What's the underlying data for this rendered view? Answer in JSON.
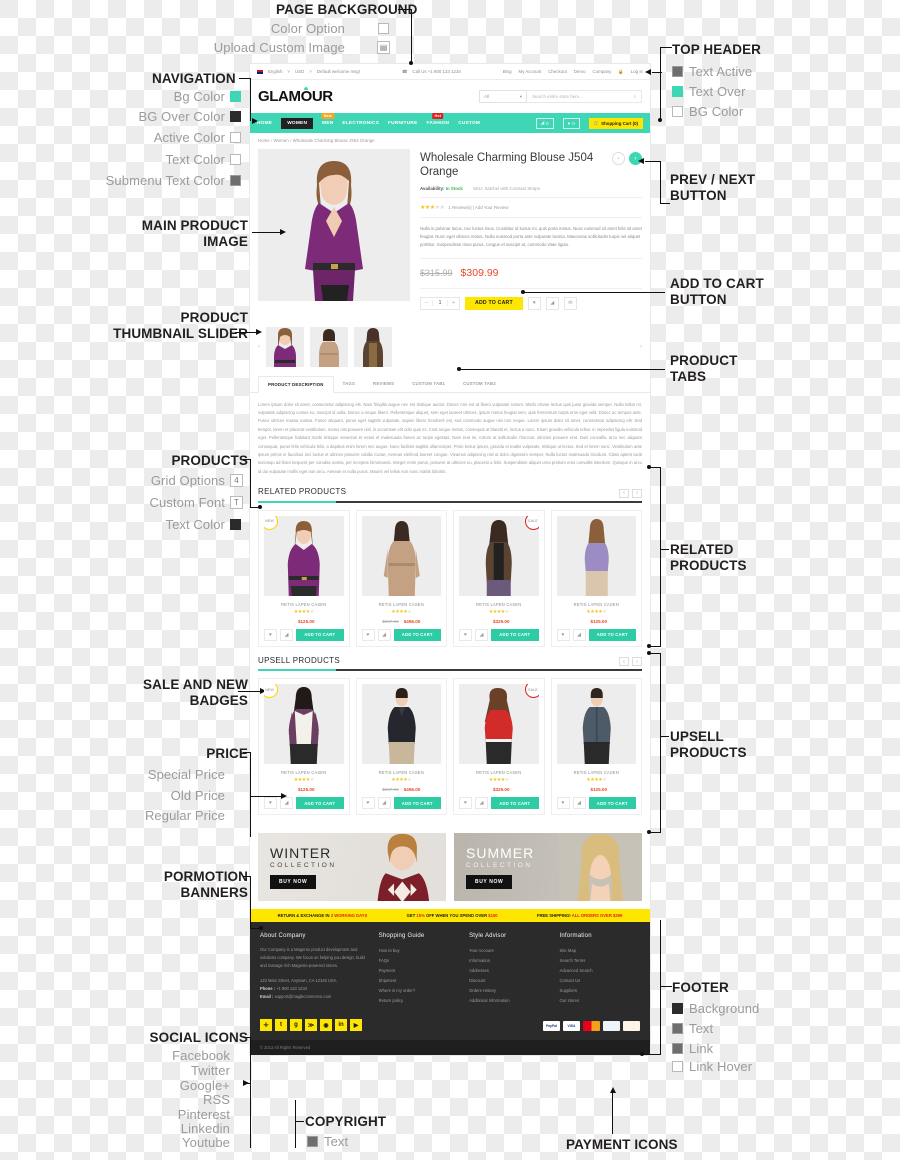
{
  "annotations": {
    "page_background": {
      "title": "PAGE BACKGROUND",
      "options": [
        {
          "label": "Color Option",
          "swatch": "white"
        },
        {
          "label": "Upload Custom Image",
          "swatch": "image"
        }
      ]
    },
    "navigation": {
      "title": "NAVIGATION",
      "options": [
        {
          "label": "Bg Color",
          "swatch": "teal"
        },
        {
          "label": "BG Over Color",
          "swatch": "dark"
        },
        {
          "label": "Active  Color",
          "swatch": "white"
        },
        {
          "label": "Text Color",
          "swatch": "white"
        },
        {
          "label": "Submenu Text Color",
          "swatch": "mid"
        }
      ]
    },
    "top_header": {
      "title": "TOP HEADER",
      "options": [
        {
          "label": "Text Active",
          "swatch": "mid"
        },
        {
          "label": "Text Over",
          "swatch": "teal"
        },
        {
          "label": "BG Color",
          "swatch": "white"
        }
      ]
    },
    "main_product_image": "MAIN PRODUCT IMAGE",
    "product_thumbnail_slider": "PRODUCT THUMBNAIL SLIDER",
    "prev_next_button": "PREV / NEXT BUTTON",
    "add_to_cart_button": "ADD TO CART BUTTON",
    "product_tabs": "PRODUCT TABS",
    "products": {
      "title": "PRODUCTS",
      "options": [
        {
          "label": "Grid Options",
          "glyph": "4"
        },
        {
          "label": "Custom Font",
          "glyph": "T"
        },
        {
          "label": "Text Color",
          "swatch": "dark"
        }
      ]
    },
    "related_products": "RELATED PRODUCTS",
    "upsell_products": "UPSELL PRODUCTS",
    "sale_and_new_badges": "SALE AND NEW BADGES",
    "price": {
      "title": "PRICE",
      "options": [
        "Special Price",
        "Old Price",
        "Regular Price"
      ]
    },
    "promotion_banners": "PORMOTION BANNERS",
    "social_icons": {
      "title": "SOCIAL ICONS",
      "items": [
        "Facebook",
        "Twitter",
        "Google+",
        "RSS",
        "Pinterest",
        "Linkedin",
        "Youtube"
      ]
    },
    "copyright": {
      "title": "COPYRIGHT",
      "options": [
        {
          "label": "Text",
          "swatch": "mid"
        }
      ]
    },
    "footer": {
      "title": "FOOTER",
      "options": [
        {
          "label": "Background",
          "swatch": "dark"
        },
        {
          "label": "Text",
          "swatch": "mid"
        },
        {
          "label": "Link",
          "swatch": "mid"
        },
        {
          "label": "Link Hover",
          "swatch": "white"
        }
      ]
    },
    "payment_icons": "PAYMENT ICONS"
  },
  "site": {
    "topbar": {
      "language": "English",
      "currency": "USD",
      "welcome": "Default welcome msg!",
      "phone": "Call Us +1 800 123 1234",
      "links": [
        "Blog",
        "My Account",
        "Checkout",
        "Demo",
        "Company",
        "Log In"
      ]
    },
    "header": {
      "logo": "GLAMOUR",
      "category_select": "All",
      "search_placeholder": "Search entire store here..."
    },
    "nav": {
      "items": [
        {
          "label": "HOME",
          "badge": ""
        },
        {
          "label": "WOMEN",
          "badge": "",
          "active": true
        },
        {
          "label": "MEN",
          "badge": "New"
        },
        {
          "label": "ELECTRONICS",
          "badge": ""
        },
        {
          "label": "FURNITURE",
          "badge": ""
        },
        {
          "label": "FASHION",
          "badge": "Hot"
        },
        {
          "label": "CUSTOM",
          "badge": ""
        }
      ],
      "compare_count": "0",
      "wishlist_count": "0",
      "cart_label": "Shopping Cart (0)"
    },
    "breadcrumb": "Home  ›  Women  ›  Wholesale Charming Blouse J504 Orange",
    "product": {
      "title": "Wholesale Charming Blouse J504 Orange",
      "availability_label": "Availability:",
      "availability_value": "In Stock",
      "sku": "SKU: Satchel with Contrast Straps",
      "stars": "★★★",
      "stars_empty": "★★",
      "reviews": "1 Review(s)  |  Add Your Review",
      "description": "Nulla in pulvinar lacus, nec luctus risus. Curabitur id luctus mi, quis porta metus. Nunc euismod sit amet felis sit amet feugiat. Nunc eget ultrices metus. Nulla euismod porta ante vulputate lacinia. Maecenas sollicitudin turpis vel aliquet porttitor. Suspendisse risus purus, congue et suscipit at, commodo vitae ligula.",
      "old_price": "$315.99",
      "new_price": "$309.99",
      "qty": "1",
      "add_to_cart": "ADD TO CART",
      "prev": "‹",
      "next": "›"
    },
    "tabs": [
      {
        "label": "PRODUCT DESCRIPTION",
        "active": true
      },
      {
        "label": "TAGS"
      },
      {
        "label": "REVIEWS"
      },
      {
        "label": "CUSTOM TAB1"
      },
      {
        "label": "CUSTOM TAB2"
      }
    ],
    "tab_body": "Lorem ipsum dolor sit amet, consectetur adipiscing elit. Nam fringilla augue nec est tristique auctor. Donec non est at libero vulputate rutrum. Morbi ornare lectus quis justo gravida semper. Nulla tellus mi, vulputate adipiscing cursus eu, suscipit id nulla. Donec a neque libero. Pellentesque aliquet, sem eget laoreet ultrices, ipsum metus feugiat sem, quis fermentum turpis eros eget velit. Donec ac tempus ante. Fusce ultrices massa massa. Fusce aliquam, purus eget sagittis vulputate, sapien libero hendrerit est, sed commodo augue nisi non neque. Lorem ipsum dolor sit amet, consectetur adipiscing elit. Sed tempor, lorem et placerat vestibulum, metus nisi posuere nisl, in accumsan elit odio quis mi. Cras neque metus, consequat at blandit et, luctus a nunc. Etiam gravida vehicula tellus, in imperdiet ligula euismod eget. Pellentesque habitant morbi tristique senectus et netus et malesuada fames ac turpis egestas. Nam erat mi, rutrum at sollicitudin rhoncus, ultricies posuere erat. Duis convallis, arcu nec aliquam consequat, purus felis vehicula felis, a dapibus enim lorem nec augue. Nunc facilisis sagittis ullamcorper. Proin lectus ipsum, gravida et mattis vulputate, tristique ut lectus. Sed et lorem nunc. Vestibulum ante ipsum primis in faucibus orci luctus et ultrices posuere cubilia Curae; Aenean eleifend laoreet congue. Vivamus adipiscing nisl ut dolor dignissim semper. Nulla luctus malesuada tincidunt. Class aptent taciti sociosqu ad litora torquent per conubia nostra, per inceptos himenaeos. Integer enim purus, posuere at ultricies eu, placerat a felis. Suspendisse aliquet urna pretium eros convallis interdum. Quisque in arcu id dui vulputate mollis eget non arcu. Aenean et nulla purus. Mauris vel tellus non nunc mattis lobortis.",
    "related": {
      "title": "RELATED PRODUCTS",
      "items": [
        {
          "name": "RETIS LAPEN CASEN",
          "badge": "NEW",
          "price": "$125.00",
          "old_price": "",
          "add": "ADD TO CART",
          "color": "#7d2a78"
        },
        {
          "name": "RETIS LAPEN CASEN",
          "badge": "",
          "price": "$456.00",
          "old_price": "$567.00",
          "add": "ADD TO CART",
          "color": "#c4a183"
        },
        {
          "name": "RETIS LAPEN CASEN",
          "badge": "SALE",
          "price": "$325.00",
          "old_price": "",
          "add": "ADD TO CART",
          "color": "#5a4330"
        },
        {
          "name": "RETIS LAPEN CASEN",
          "badge": "",
          "price": "$125.00",
          "old_price": "",
          "add": "ADD TO CART",
          "color": "#9d8bc4"
        }
      ]
    },
    "upsell": {
      "title": "UPSELL PRODUCTS",
      "items": [
        {
          "name": "RETIS LAPEN CASEN",
          "badge": "NEW",
          "price": "$125.00",
          "old_price": "",
          "add": "ADD TO CART",
          "color": "#6b3f63"
        },
        {
          "name": "RETIS LAPEN CASEN",
          "badge": "",
          "price": "$456.00",
          "old_price": "$567.00",
          "add": "ADD TO CART",
          "color": "#26262e"
        },
        {
          "name": "RETIS LAPEN CASEN",
          "badge": "SALE",
          "price": "$325.00",
          "old_price": "",
          "add": "ADD TO CART",
          "color": "#d32a2a"
        },
        {
          "name": "RETIS LAPEN CASEN",
          "badge": "",
          "price": "$125.00",
          "old_price": "",
          "add": "ADD TO CART",
          "color": "#4d5a68"
        }
      ]
    },
    "promos": [
      {
        "big": "WINTER",
        "small": "COLLECTION",
        "button": "BUY NOW"
      },
      {
        "big": "SUMMER",
        "small": "COLLECTION",
        "button": "BUY NOW"
      }
    ],
    "infobar": [
      {
        "pre": "RETURN & EXCHANGE IN",
        "hi": "3 WORKING DAYS"
      },
      {
        "pre": "GET",
        "hi": "15%",
        "mid": "OFF WHEN YOU SPEND OVER",
        "hi2": "$100"
      },
      {
        "pre": "FREE SHIPPING!",
        "hi": "ALL ORDERS OVER $299"
      }
    ],
    "footer": {
      "columns": [
        {
          "title": "About Company",
          "text": "Our Company is a Magento product development and solutions company. We focus on helping you design, build and manage rich Magento-powered stores.",
          "address": "123 Main Street, Anytown, CA 12345 USA",
          "phone_label": "Phone :",
          "phone": "+1 800 123 1234",
          "email_label": "Email :",
          "email": "support@magikcommerce.com"
        },
        {
          "title": "Shopping Guide",
          "links": [
            "How to buy",
            "FAQs",
            "Payment",
            "Shipment",
            "Where is my order?",
            "Return policy"
          ]
        },
        {
          "title": "Style Advisor",
          "links": [
            "Your Account",
            "Information",
            "Addresses",
            "Discount",
            "Orders History",
            "Additional Information"
          ]
        },
        {
          "title": "Information",
          "links": [
            "Site Map",
            "Search Terms",
            "Advanced Search",
            "Contact Us",
            "Suppliers",
            "Our stores"
          ]
        }
      ],
      "social": [
        "✛",
        "🐦",
        "g",
        "≫",
        "◉",
        "in",
        "▶"
      ],
      "payments": [
        "PayPal",
        "VISA",
        "MC",
        "AMEX",
        "DISC"
      ],
      "copyright": "© 2013 All Rights Reserved"
    }
  }
}
